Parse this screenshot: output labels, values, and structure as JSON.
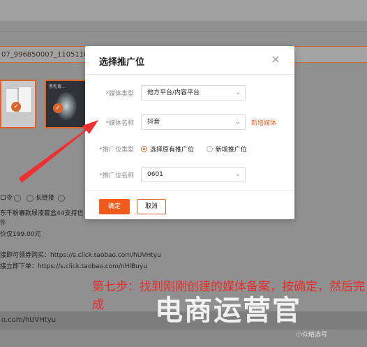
{
  "background": {
    "id_text": "07_996850007_1105116000006",
    "link_options": [
      "口令",
      "长链接"
    ],
    "lines": [
      "东千粉褰款尿液套盒44支持信",
      "件",
      "价仅199.00元",
      "接即可领券购买：https://s.click.taobao.com/hUVHtyu",
      "接立即下单：https://s.click.taobao.com/nHlBuyu"
    ],
    "bottom_url": "o.com/hUVHtyu",
    "thumb2_caption": "黑乳膏..."
  },
  "modal": {
    "title": "选择推广位",
    "close_icon": "close-icon",
    "fields": {
      "media_type_label": "*媒体类型",
      "media_type_value": "他方平台/内容平台",
      "media_name_label": "*媒体名称",
      "media_name_value": "抖音",
      "new_media_link": "新增媒体",
      "slot_type_label": "*推广位类型",
      "slot_type_options": [
        "选择原有推广位",
        "新增推广位"
      ],
      "slot_name_label": "*推广位名称",
      "slot_name_value": "0601"
    },
    "confirm_label": "确定",
    "cancel_label": "取消"
  },
  "annotation": {
    "caption": "第七步：找到刚刚创建的媒体备案，按确定，然后完成",
    "watermark": "电商运营官",
    "watermark_small": "小众精选号"
  },
  "colors": {
    "accent": "#f05a1a",
    "annotation_red": "#e82c2c"
  }
}
